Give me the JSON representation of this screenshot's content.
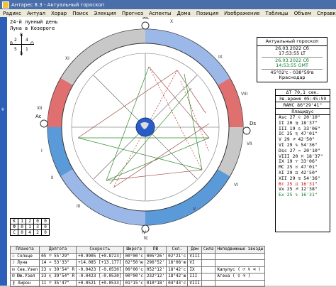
{
  "window": {
    "title": "Антарес 8.3 - Актуальный гороскоп"
  },
  "menu": [
    "Радикс",
    "Актуал",
    "Хорар",
    "Поиск",
    "Элекция",
    "Прогноз",
    "Аспекты",
    "Дома",
    "Позиция",
    "Изображение",
    "Таблицы",
    "Объем",
    "Справка"
  ],
  "moon_info": {
    "line1": "24-й лунный день",
    "line2": "Луна в Козероге"
  },
  "cross": {
    "top": "В",
    "left": "В",
    "right": "О",
    "bottom": "В",
    "tl": "2",
    "tr": "4",
    "bl": "5",
    "br": "1"
  },
  "left_marker": "+",
  "houses": [
    "I",
    "II",
    "III",
    "IV",
    "V",
    "VI",
    "VII",
    "VIII",
    "IX",
    "X",
    "XI",
    "XII"
  ],
  "angles": {
    "asc": "Ac",
    "dsc": "Ds",
    "mc": "Mc",
    "ic": "Ic"
  },
  "colors": {
    "titlebar": "#4a6ea9",
    "fire": "#e07070",
    "earth": "#909090",
    "air": "#9bb8e8",
    "water": "#5a9ad8",
    "aspect_green": "#2e8b2e",
    "aspect_red": "#c03030",
    "aspect_brown": "#a05050",
    "center_globe": "#2a5cc8"
  },
  "elements_table": [
    [
      "К",
      "1",
      "2",
      "0",
      "0"
    ],
    [
      "Ф",
      "0",
      "1",
      "3",
      "0"
    ],
    [
      "С",
      "0",
      "4",
      "2",
      "0"
    ]
  ],
  "chart_panel": {
    "title": "Актуальный гороскоп",
    "date_lt": "26.03.2022 Сб",
    "time_lt": "17:53:55 LT",
    "date_gmt": "26.03.2022 Сб",
    "time_gmt": "14:53:55 GMT",
    "coords": "45°02'с - 038°59'в",
    "city": "Краснодар"
  },
  "houses_panel": {
    "header1": "ΔT 70,1 сек.",
    "header2": "Эв.время 05:45:59",
    "header3": "RAMC 86°29'41\"",
    "header4": "Плацидус",
    "rows": [
      {
        "label": "Asc",
        "value": "27 ♌ 20'10\"",
        "color": "black"
      },
      {
        "label": "II",
        "value": "20 ♍ 18'37\"",
        "color": "black"
      },
      {
        "label": "III",
        "value": "19 ♎ 33'06\"",
        "color": "black"
      },
      {
        "label": "IC",
        "value": "25 ♏ 47'01\"",
        "color": "black"
      },
      {
        "label": "V",
        "value": "29 ♐ 42'50\"",
        "color": "black"
      },
      {
        "label": "VI",
        "value": "29 ♑ 54'36\"",
        "color": "black"
      },
      {
        "label": "Dsc",
        "value": "27 ♒ 20'10\"",
        "color": "black"
      },
      {
        "label": "VIII",
        "value": "20 ♓ 18'37\"",
        "color": "black"
      },
      {
        "label": "IX",
        "value": "19 ♈ 33'06\"",
        "color": "black"
      },
      {
        "label": "MC",
        "value": "25 ♉ 47'01\"",
        "color": "black"
      },
      {
        "label": "XI",
        "value": "29 ♊ 42'50\"",
        "color": "black"
      },
      {
        "label": "XII",
        "value": "29 ♋ 54'36\"",
        "color": "black"
      },
      {
        "label": "Вт",
        "value": "25 ♊ 16'31\"",
        "color": "red"
      },
      {
        "label": "Vx",
        "value": "25 ♐ 12'38\"",
        "color": "black"
      },
      {
        "label": "Ex",
        "value": "25 ♑ 16'31\"",
        "color": "green"
      }
    ]
  },
  "planet_table": {
    "headers": [
      "Планета",
      "Долгота",
      "Скорость",
      "Широта",
      "ПВ",
      "Скл.",
      "Дом",
      "Сила",
      "Неподвижные звезды"
    ],
    "rows": [
      [
        "☉ Солнце",
        "05 ♈ 55'29\"",
        "+0.9905 [+0.8723]",
        "00°00'с",
        "005°26'",
        "02°21'с",
        "VIII",
        "",
        ""
      ],
      [
        "☽ Луна",
        "14 ♒ 53'33\"",
        "+14.085 [+13.177]",
        "02°50'ю",
        "296°52'",
        "18°08'ю",
        "VI",
        "",
        ""
      ],
      [
        "☊ Сев.Узел",
        "23 ♉ 39'54\" R",
        "-0.0423 [-0.0530]",
        "00°00'с",
        "052°12'",
        "18°42'с",
        "IX",
        "",
        "Капулус ( ♂ ☿ ♃ )"
      ],
      [
        "☋ Юж.Узел",
        "23 ♏ 39'54\" R",
        "-0.0423 [-0.0530]",
        "00°00'с",
        "232°12'",
        "18°42'ю",
        "III",
        "",
        "Агена ( ♀ ♃ )"
      ],
      [
        "⚷ Хирон",
        "11 ♈ 35'47\"",
        "+0.0521 [+0.0533]",
        "01°15'с",
        "010°18'",
        "04°43'с",
        "VIII",
        "",
        ""
      ]
    ]
  }
}
